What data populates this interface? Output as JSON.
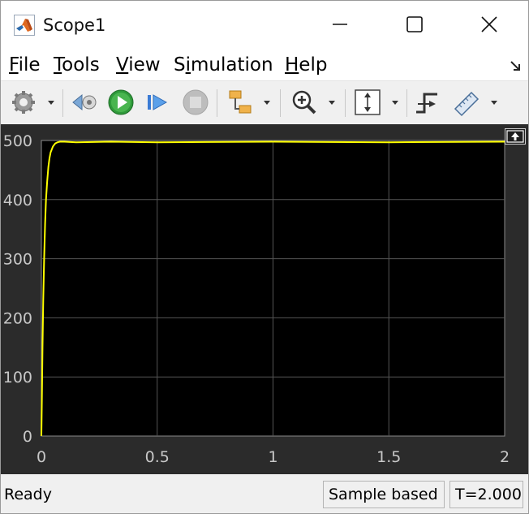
{
  "window": {
    "title": "Scope1",
    "icon": "matlab-logo-icon",
    "controls": [
      "minimize-icon",
      "maximize-icon",
      "close-icon"
    ]
  },
  "menu": {
    "items": [
      {
        "label": "File",
        "accel": "F"
      },
      {
        "label": "Tools",
        "accel": "T"
      },
      {
        "label": "View",
        "accel": "V"
      },
      {
        "label": "Simulation",
        "accel": "i"
      },
      {
        "label": "Help",
        "accel": "H"
      }
    ]
  },
  "toolbar": {
    "icons": [
      "gear-icon",
      "step-back-icon",
      "run-icon",
      "step-forward-icon",
      "stop-icon",
      "highlight-block-icon",
      "zoom-in-icon",
      "scale-axes-icon",
      "triggers-icon",
      "measurements-icon"
    ]
  },
  "chart_data": {
    "type": "line",
    "title": "",
    "xlabel": "",
    "ylabel": "",
    "xlim": [
      0,
      2
    ],
    "ylim": [
      0,
      500
    ],
    "xticks": [
      "0",
      "0.5",
      "1",
      "1.5",
      "2"
    ],
    "yticks": [
      "0",
      "100",
      "200",
      "300",
      "400",
      "500"
    ],
    "grid": true,
    "series": [
      {
        "color": "#ffff00",
        "x": [
          0,
          0.002,
          0.005,
          0.008,
          0.012,
          0.016,
          0.02,
          0.025,
          0.03,
          0.035,
          0.04,
          0.05,
          0.06,
          0.07,
          0.08,
          0.1,
          0.15,
          0.3,
          0.5,
          1.0,
          1.5,
          2.0
        ],
        "y": [
          0,
          60,
          150,
          230,
          300,
          360,
          400,
          430,
          455,
          470,
          480,
          490,
          495,
          497,
          498,
          498,
          497,
          498,
          497,
          498,
          497,
          498
        ]
      }
    ]
  },
  "status": {
    "text": "Ready",
    "mode": "Sample based",
    "time": "T=2.000"
  },
  "colors": {
    "plot_bg": "#000000",
    "figure_bg": "#2b2b2b",
    "grid": "#555555",
    "line": "#ffff00",
    "tick_text": "#c8c8c8"
  }
}
